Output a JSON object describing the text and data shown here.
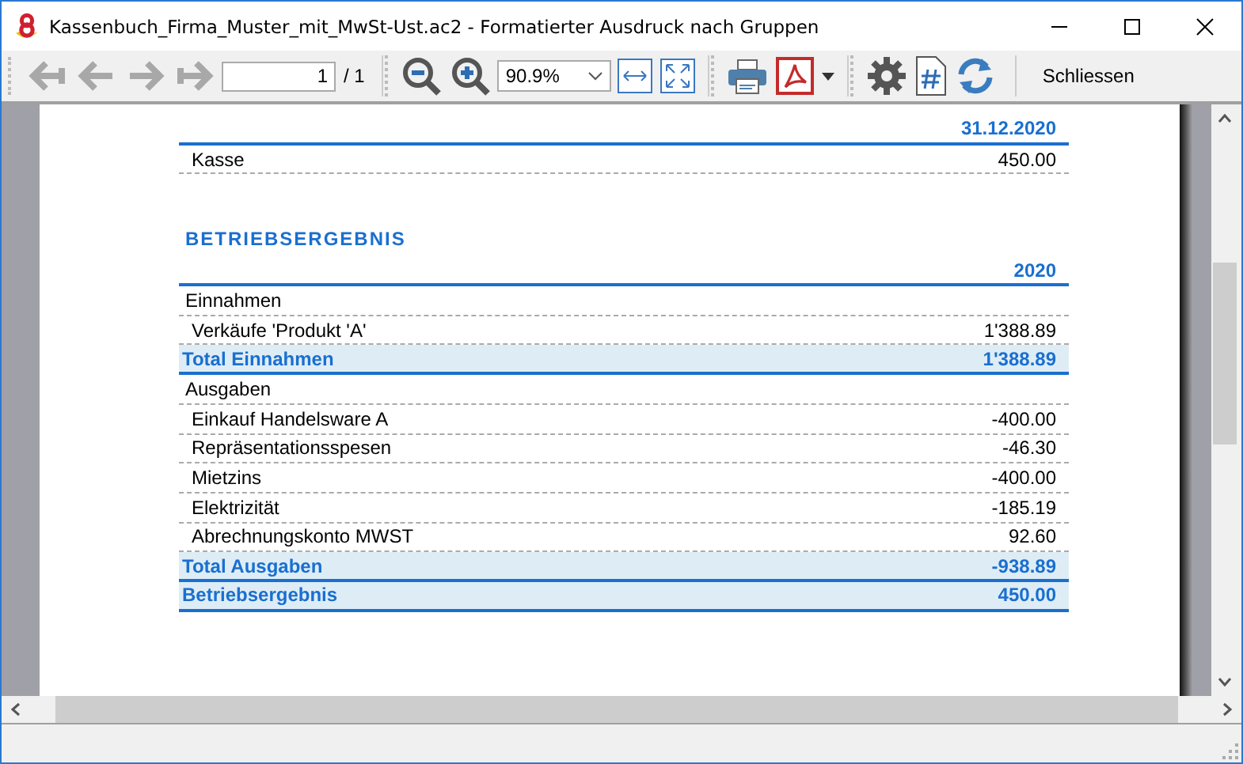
{
  "window": {
    "title": "Kassenbuch_Firma_Muster_mit_MwSt-Ust.ac2 - Formatierter Ausdruck nach Gruppen"
  },
  "toolbar": {
    "page": "1",
    "page_total": "/ 1",
    "zoom": "90.9%",
    "close_button": "Schliessen"
  },
  "report": [
    {
      "kind": "column_header",
      "value": "31.12.2020"
    },
    {
      "kind": "item",
      "label": "Kasse",
      "value": "450.00"
    },
    {
      "kind": "spacer"
    },
    {
      "kind": "section_title",
      "label": "BETRIEBSERGEBNIS"
    },
    {
      "kind": "column_header",
      "value": "2020"
    },
    {
      "kind": "group",
      "label": "Einnahmen"
    },
    {
      "kind": "item",
      "label": "Verkäufe 'Produkt 'A'",
      "value": "1'388.89"
    },
    {
      "kind": "total",
      "label": "Total Einnahmen",
      "value": "1'388.89"
    },
    {
      "kind": "group",
      "label": "Ausgaben"
    },
    {
      "kind": "item",
      "label": "Einkauf Handelsware A",
      "value": "-400.00"
    },
    {
      "kind": "item",
      "label": "Repräsentationsspesen",
      "value": "-46.30"
    },
    {
      "kind": "item",
      "label": "Mietzins",
      "value": "-400.00"
    },
    {
      "kind": "item",
      "label": "Elektrizität",
      "value": "-185.19"
    },
    {
      "kind": "item",
      "label": "Abrechnungskonto MWST",
      "value": "92.60"
    },
    {
      "kind": "total",
      "label": "Total Ausgaben",
      "value": "-938.89"
    },
    {
      "kind": "result",
      "label": "Betriebsergebnis",
      "value": "450.00"
    }
  ]
}
